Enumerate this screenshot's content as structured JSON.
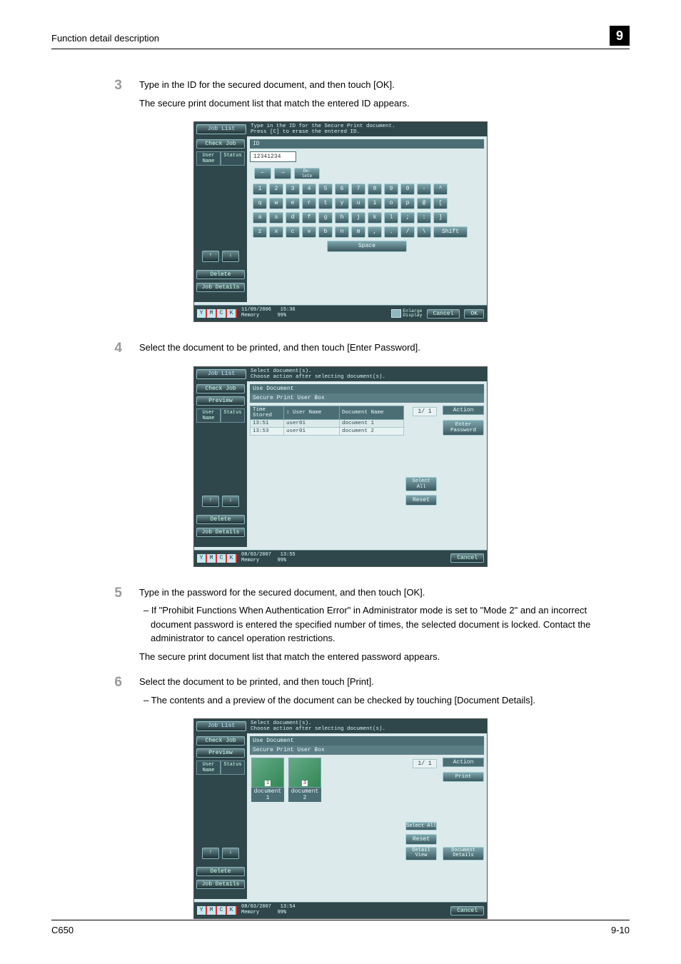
{
  "header": {
    "left": "Function detail description",
    "chapter": "9"
  },
  "footer": {
    "left": "C650",
    "right": "9-10"
  },
  "steps": {
    "s3": {
      "num": "3",
      "p1": "Type in the ID for the secured document, and then touch [OK].",
      "p2": "The secure print document list that match the entered ID appears."
    },
    "s4": {
      "num": "4",
      "p1": "Select the document to be printed, and then touch [Enter Password]."
    },
    "s5": {
      "num": "5",
      "p1": "Type in the password for the secured document, and then touch [OK].",
      "sub1": "–   If \"Prohibit Functions When Authentication Error\" in Administrator mode is set to \"Mode 2\" and an incorrect document password is entered the specified number of times, the selected document is locked. Contact the administrator to cancel operation restrictions.",
      "p2": "The secure print document list that match the entered password appears."
    },
    "s6": {
      "num": "6",
      "p1": "Select the document to be printed, and then touch [Print].",
      "sub1": "–   The contents and a preview of the document can be checked by touching [Document Details]."
    }
  },
  "panel_common": {
    "job_list": "Job List",
    "check_job": "Check Job",
    "preview": "Preview",
    "user_name_tab": "User\nName",
    "status_tab": "Status",
    "delete": "Delete",
    "job_details": "Job Details",
    "arrow_up": "↑",
    "arrow_down": "↓",
    "ymck": [
      "Y",
      "M",
      "C",
      "K"
    ],
    "memory_label": "Memory",
    "enlarge": "Enlarge\nDisplay",
    "cancel": "Cancel",
    "ok": "OK",
    "select_all": "Select\nAll",
    "reset": "Reset",
    "detail_view": "Detail\nView",
    "document_details": "Document\nDetails",
    "action": "Action",
    "use_document": "Use Document",
    "secure_box": "Secure Print User Box",
    "pager": "1/  1"
  },
  "panel1": {
    "msg": "Type in the ID for the Secure Print document.\nPress [C] to erase the entered ID.",
    "id_label": "ID",
    "id_value": "12341234",
    "nav_left": "←",
    "nav_right": "→",
    "nav_del": "De-\nlete",
    "row_num": [
      "1",
      "2",
      "3",
      "4",
      "5",
      "6",
      "7",
      "8",
      "9",
      "0",
      "-",
      "^"
    ],
    "row_q": [
      "q",
      "w",
      "e",
      "r",
      "t",
      "y",
      "u",
      "i",
      "o",
      "p",
      "@",
      "["
    ],
    "row_a": [
      "a",
      "s",
      "d",
      "f",
      "g",
      "h",
      "j",
      "k",
      "l",
      ";",
      ":",
      "]"
    ],
    "row_z": [
      "z",
      "x",
      "c",
      "v",
      "b",
      "n",
      "m",
      ",",
      ".",
      "/",
      "\\",
      "Shift"
    ],
    "space": "Space",
    "date": "11/09/2006",
    "time": "15:36",
    "memory": "99%"
  },
  "panel2": {
    "msg": "Select document(s).\nChoose action after selecting document(s).",
    "cols": {
      "time": "Time\nStored",
      "user": "User Name",
      "doc": "Document Name"
    },
    "rows": [
      {
        "time": "13:51",
        "user": "user01",
        "doc": "document 1"
      },
      {
        "time": "13:53",
        "user": "user01",
        "doc": "document 2"
      }
    ],
    "enter_password": "Enter\nPassword",
    "date": "08/03/2007",
    "time": "13:55",
    "memory": "99%"
  },
  "panel3": {
    "msg": "Select document(s).\nChoose action after selecting document(s).",
    "thumbs": [
      {
        "num": "1",
        "cap": "document 1"
      },
      {
        "num": "3",
        "cap": "document 2"
      }
    ],
    "print_btn": "Print",
    "date": "08/03/2007",
    "time": "13:54",
    "memory": "99%"
  }
}
